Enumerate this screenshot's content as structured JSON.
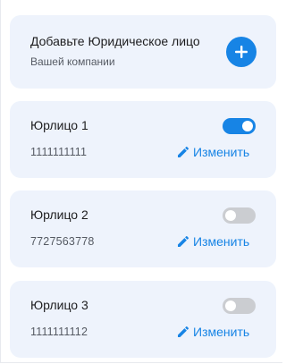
{
  "add_card": {
    "title": "Добавьте Юридическое лицо",
    "subtitle": "Вашей компании",
    "button_icon": "plus-icon"
  },
  "entities": [
    {
      "name": "Юрлицо 1",
      "number": "1111111111",
      "active": true,
      "edit_label": "Изменить"
    },
    {
      "name": "Юрлицо 2",
      "number": "7727563778",
      "active": false,
      "edit_label": "Изменить"
    },
    {
      "name": "Юрлицо 3",
      "number": "1111111112",
      "active": false,
      "edit_label": "Изменить"
    }
  ],
  "colors": {
    "accent": "#1784e5",
    "card_background": "#eef3fc",
    "toggle_off": "#cbcdd1"
  }
}
